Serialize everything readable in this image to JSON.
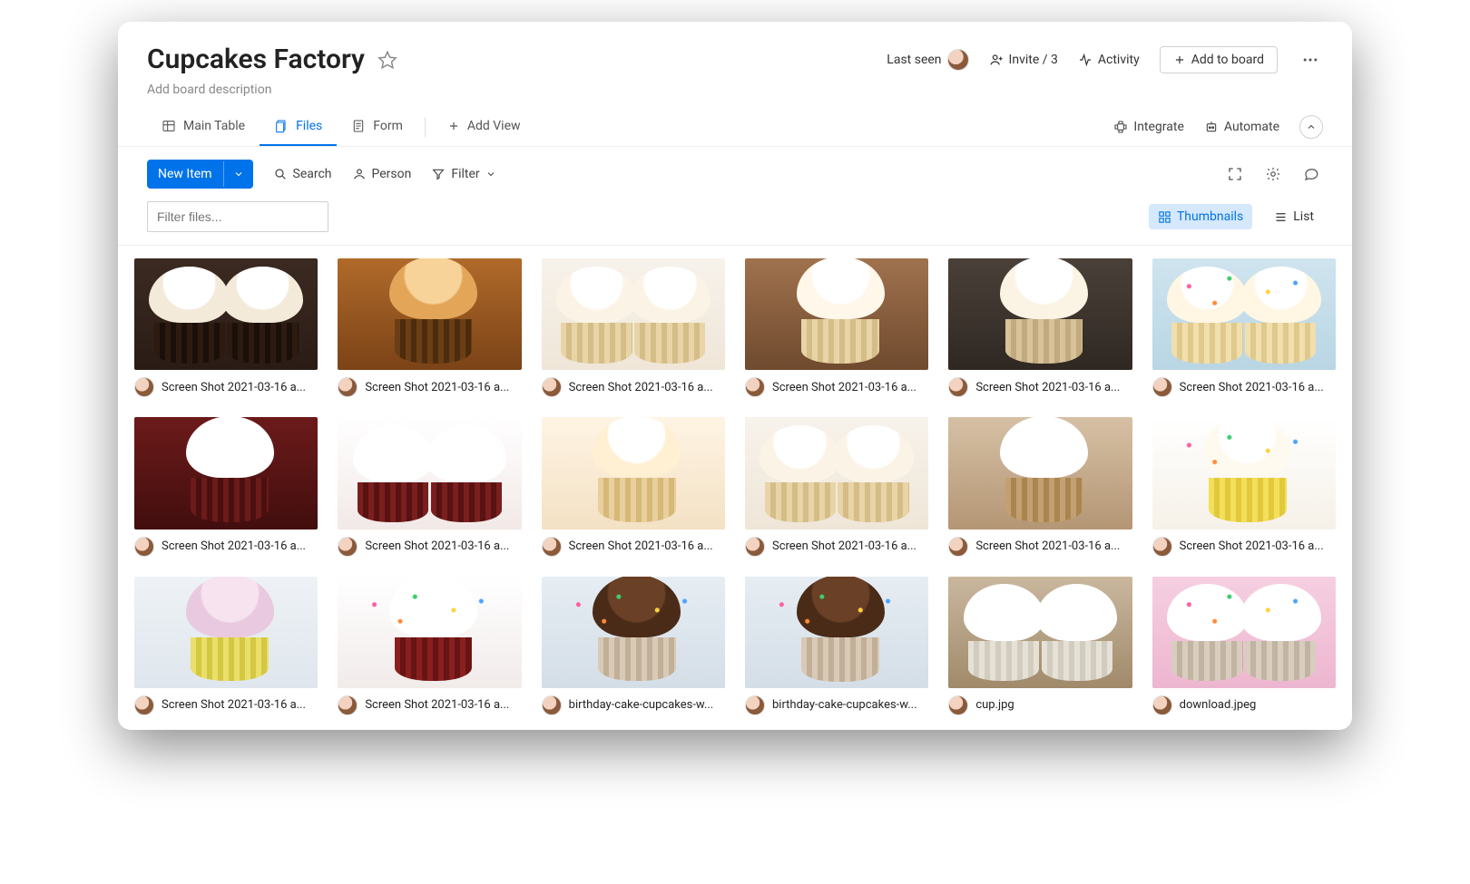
{
  "header": {
    "board_title": "Cupcakes Factory",
    "description_placeholder": "Add board description",
    "last_seen_label": "Last seen",
    "invite_label": "Invite / 3",
    "activity_label": "Activity",
    "add_to_board_label": "Add to board"
  },
  "tabs": {
    "main_table": "Main Table",
    "files": "Files",
    "form": "Form",
    "add_view": "Add View",
    "integrate": "Integrate",
    "automate": "Automate"
  },
  "toolbar": {
    "new_item": "New Item",
    "search": "Search",
    "person": "Person",
    "filter": "Filter"
  },
  "filter_row": {
    "filter_placeholder": "Filter files...",
    "thumbnails": "Thumbnails",
    "list": "List"
  },
  "files": [
    {
      "name": "Screen Shot 2021-03-16 a...",
      "palette": "p-choc-cream",
      "layout": "pair",
      "sprinkles": false
    },
    {
      "name": "Screen Shot 2021-03-16 a...",
      "palette": "p-caramel",
      "layout": "single",
      "sprinkles": false
    },
    {
      "name": "Screen Shot 2021-03-16 a...",
      "palette": "p-vanilla",
      "layout": "pair",
      "sprinkles": false
    },
    {
      "name": "Screen Shot 2021-03-16 a...",
      "palette": "p-vanilla-wood",
      "layout": "single",
      "sprinkles": false
    },
    {
      "name": "Screen Shot 2021-03-16 a...",
      "palette": "p-vanilla-dk",
      "layout": "single",
      "sprinkles": false
    },
    {
      "name": "Screen Shot 2021-03-16 a...",
      "palette": "p-party",
      "layout": "pair",
      "sprinkles": true
    },
    {
      "name": "Screen Shot 2021-03-16 a...",
      "palette": "p-redvelvet",
      "layout": "single",
      "sprinkles": false
    },
    {
      "name": "Screen Shot 2021-03-16 a...",
      "palette": "p-redvelvet-lt",
      "layout": "pair",
      "sprinkles": false
    },
    {
      "name": "Screen Shot 2021-03-16 a...",
      "palette": "p-caramel-lt",
      "layout": "single",
      "sprinkles": false
    },
    {
      "name": "Screen Shot 2021-03-16 a...",
      "palette": "p-vanilla",
      "layout": "pair",
      "sprinkles": false
    },
    {
      "name": "Screen Shot 2021-03-16 a...",
      "palette": "p-cinn",
      "layout": "single",
      "sprinkles": false
    },
    {
      "name": "Screen Shot 2021-03-16 a...",
      "palette": "p-funfetti",
      "layout": "single",
      "sprinkles": true
    },
    {
      "name": "Screen Shot 2021-03-16 a...",
      "palette": "p-blueberry",
      "layout": "single",
      "sprinkles": false
    },
    {
      "name": "Screen Shot 2021-03-16 a...",
      "palette": "p-rv-top",
      "layout": "single",
      "sprinkles": true
    },
    {
      "name": "birthday-cake-cupcakes-w...",
      "palette": "p-choc-sprk",
      "layout": "single",
      "sprinkles": true
    },
    {
      "name": "birthday-cake-cupcakes-w...",
      "palette": "p-choc-sprk",
      "layout": "single",
      "sprinkles": true
    },
    {
      "name": "cup.jpg",
      "palette": "p-assort-wood",
      "layout": "pair",
      "sprinkles": false
    },
    {
      "name": "download.jpeg",
      "palette": "p-assort-pink",
      "layout": "pair",
      "sprinkles": true
    }
  ]
}
